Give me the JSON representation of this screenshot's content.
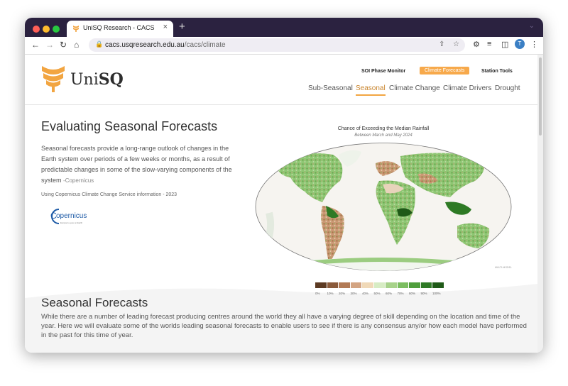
{
  "browser": {
    "tab_title": "UniSQ Research - CACS",
    "tab_close": "×",
    "new_tab": "+",
    "url_domain": "cacs.usqresearch.edu.au",
    "url_path": "/cacs/climate",
    "avatar_initial": "T",
    "colors": {
      "frame": "#2b2240",
      "close": "#ff5f57",
      "min": "#febc2e",
      "max": "#28c840"
    }
  },
  "site": {
    "logo_text_prefix": "Uni",
    "logo_text_suffix": "SQ",
    "brand_color": "#f2a541",
    "util_nav": [
      "SOI Phase Monitor",
      "Climate Forecasts",
      "Station Tools"
    ],
    "main_nav": [
      "Sub-Seasonal",
      "Seasonal",
      "Climate Change",
      "Climate Drivers",
      "Drought"
    ]
  },
  "hero": {
    "title": "Evaluating Seasonal Forecasts",
    "description": "Seasonal forecasts provide a long-range outlook of changes in the Earth system over periods of a few weeks or months, as a result of predictable changes in some of the slow-varying components of the system",
    "citation": "-Copernicus",
    "ccs_note": "Using Copernicus Climate Change Service information - 2023",
    "copernicus_logo": "opernicus",
    "copernicus_logo_c": "C",
    "copernicus_tagline": "Europe's eyes on Earth"
  },
  "map": {
    "title": "Chance of Exceeding the Median Rainfall",
    "subtitle": "Between March and May 2024",
    "watermark": "MULTI-MODEL",
    "legend_labels": [
      "0%",
      "10%",
      "20%",
      "30%",
      "40%",
      "50%",
      "60%",
      "70%",
      "80%",
      "90%",
      "100%"
    ],
    "legend_colors": [
      "#5c3a22",
      "#8a5a3a",
      "#b27a55",
      "#d3a482",
      "#f0d9b8",
      "#d7ecc4",
      "#a7d28a",
      "#7bbd60",
      "#4f9e3c",
      "#2e7a25",
      "#1f5a18"
    ]
  },
  "section": {
    "title": "Seasonal Forecasts",
    "text": "While there are a number of leading forecast producing centres around the world they all have a varying degree of skill depending on the location and time of the year. Here we will evaluate some of the worlds leading seasonal forecasts to enable users to see if there is any consensus any/or how each model have performed in the past for this time of year."
  }
}
